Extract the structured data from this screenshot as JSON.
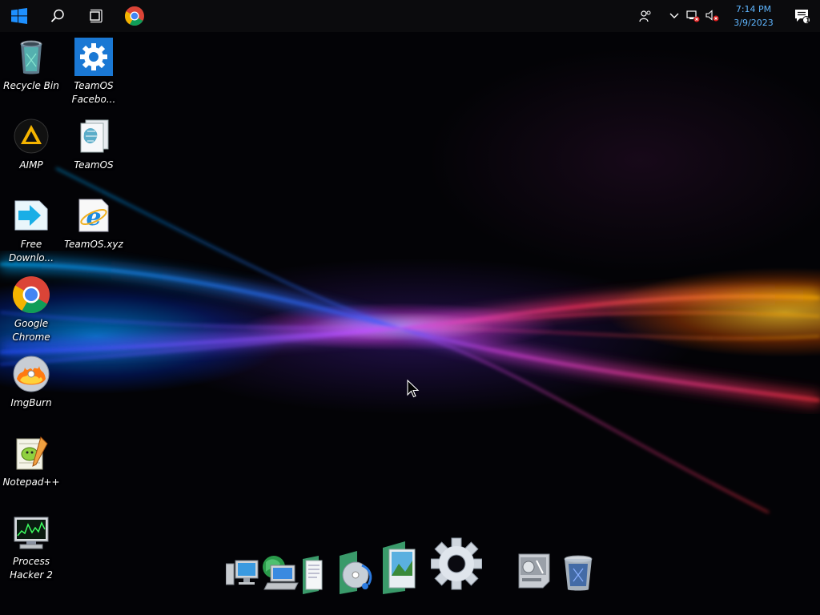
{
  "taskbar": {
    "start_icon": "windows-logo-icon",
    "search_icon": "search-icon",
    "taskview_icon": "task-view-icon",
    "chrome_icon": "chrome-icon",
    "tray": {
      "people_icon": "people-icon",
      "chevron_icon": "chevron-up-icon",
      "network_icon": "network-disconnected-icon",
      "volume_icon": "volume-muted-icon",
      "time": "7:14 PM",
      "date": "3/9/2023",
      "notification_count": "1"
    }
  },
  "desktop_icons": [
    {
      "label": "Recycle Bin",
      "icon": "recycle-bin-icon"
    },
    {
      "label": "TeamOS\nFacebo...",
      "icon": "settings-gear-icon"
    },
    {
      "label": "AIMP",
      "icon": "aimp-icon"
    },
    {
      "label": "TeamOS",
      "icon": "teamos-document-icon"
    },
    {
      "label": "Free\nDownlo...",
      "icon": "free-download-manager-icon"
    },
    {
      "label": "TeamOS.xyz",
      "icon": "internet-explorer-icon"
    },
    {
      "label": "Google\nChrome",
      "icon": "chrome-icon"
    },
    {
      "label": "ImgBurn",
      "icon": "imgburn-icon"
    },
    {
      "label": "Notepad++",
      "icon": "notepadpp-icon"
    },
    {
      "label": "Process\nHacker 2",
      "icon": "process-hacker-icon"
    }
  ],
  "dock": [
    {
      "icon": "computer-icon"
    },
    {
      "icon": "network-icon"
    },
    {
      "icon": "documents-icon"
    },
    {
      "icon": "music-icon"
    },
    {
      "icon": "pictures-icon"
    },
    {
      "icon": "settings-gear-icon"
    },
    {
      "icon": "control-panel-icon"
    },
    {
      "icon": "recycle-bin-icon"
    }
  ],
  "colors": {
    "taskbar_bg": "#0b0b0d",
    "clock_text": "#5fb6ff",
    "start_blue": "#1e90ff"
  }
}
